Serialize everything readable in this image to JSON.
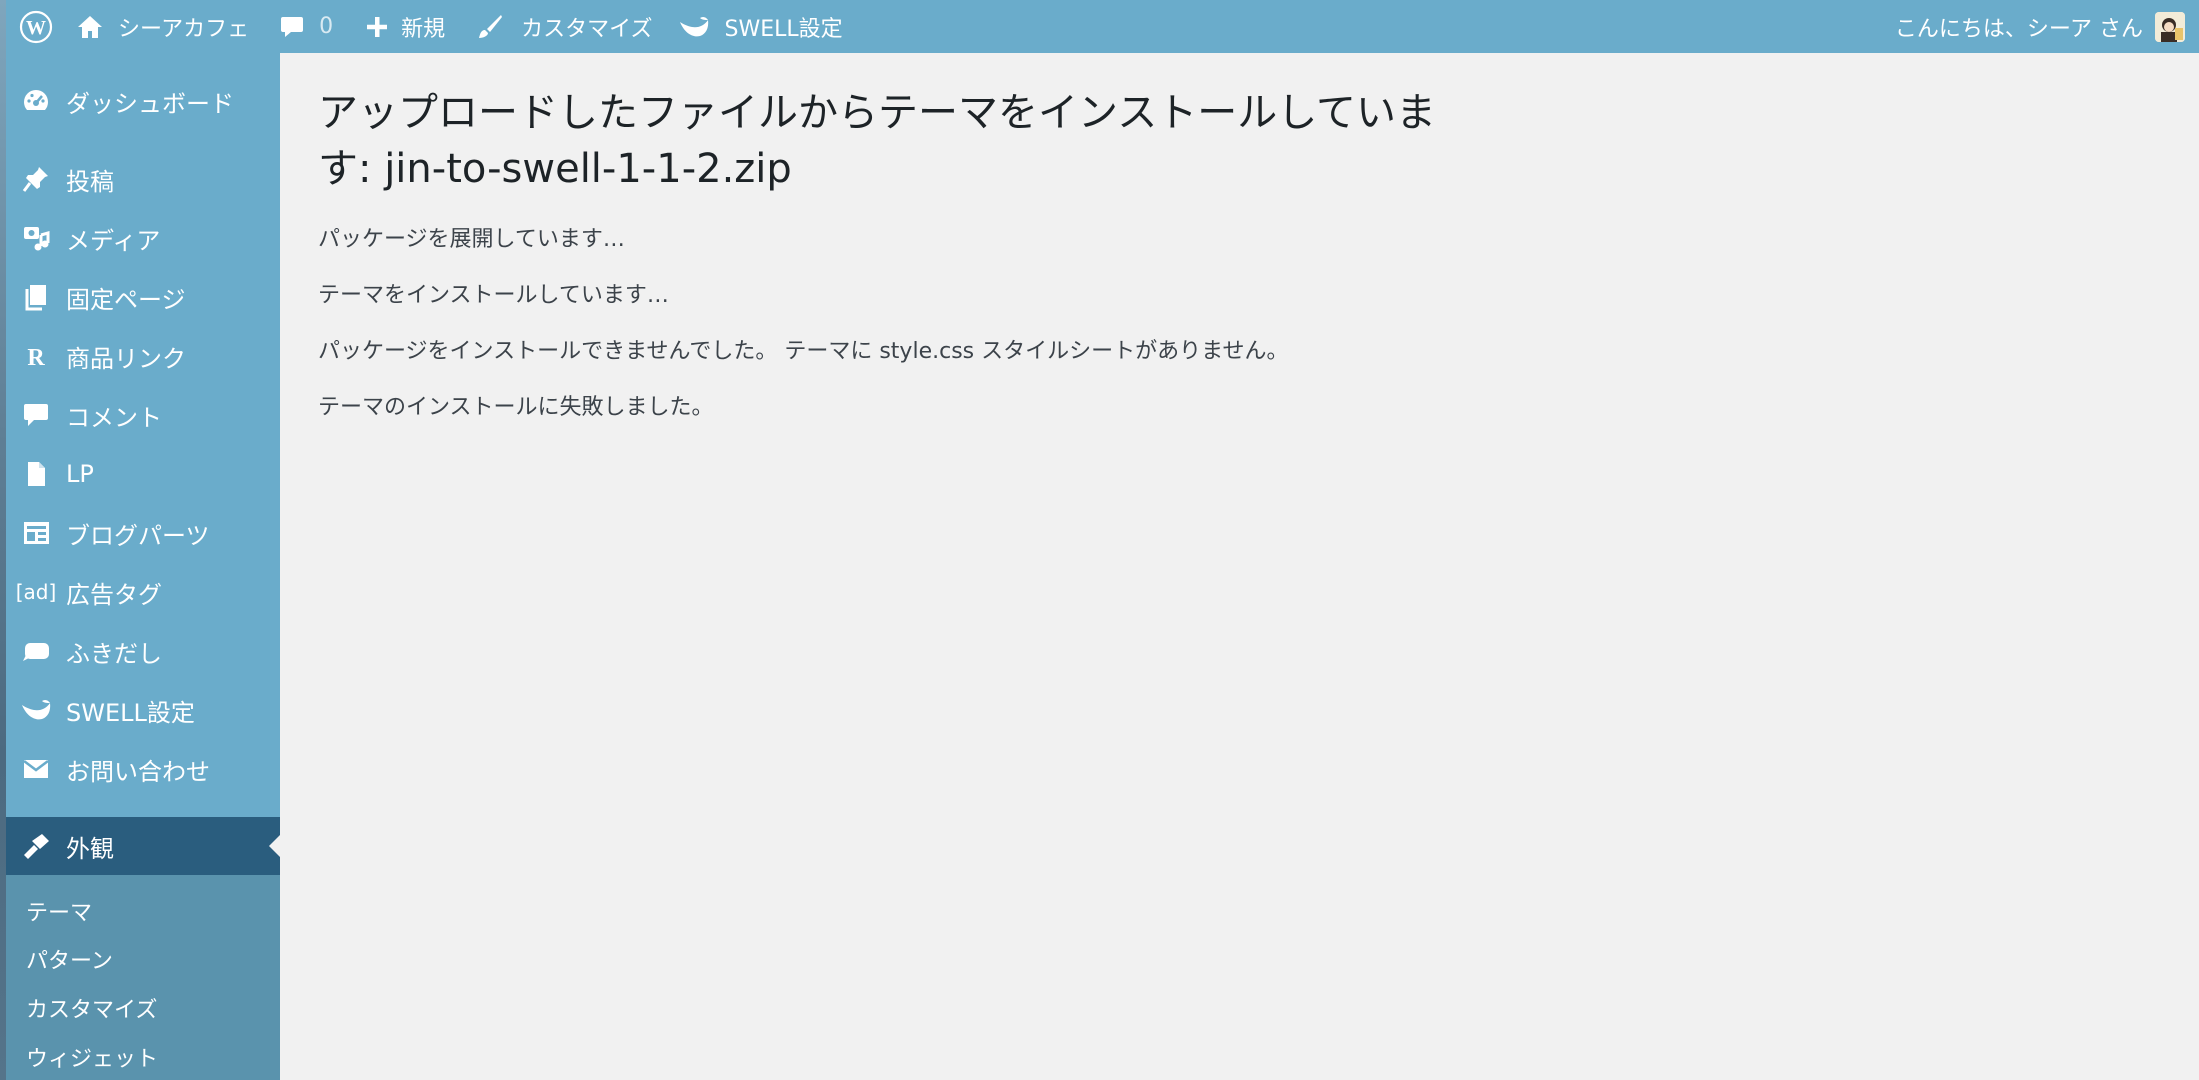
{
  "adminbar": {
    "site_name": "シーアカフェ",
    "comments_count": "0",
    "new_label": "新規",
    "customize_label": "カスタマイズ",
    "swell_label": "SWELL設定",
    "greeting": "こんにちは、シーア さん"
  },
  "sidebar": {
    "items": [
      {
        "label": "ダッシュボード",
        "icon": "dashboard-icon"
      },
      {
        "label": "投稿",
        "icon": "pin-icon"
      },
      {
        "label": "メディア",
        "icon": "media-icon"
      },
      {
        "label": "固定ページ",
        "icon": "pages-icon"
      },
      {
        "label": "商品リンク",
        "icon": "r-icon"
      },
      {
        "label": "コメント",
        "icon": "comment-icon"
      },
      {
        "label": "LP",
        "icon": "document-icon"
      },
      {
        "label": "ブログパーツ",
        "icon": "layout-icon"
      },
      {
        "label": "広告タグ",
        "icon": "ad-icon",
        "icon_text": "[ad]"
      },
      {
        "label": "ふきだし",
        "icon": "balloon-icon"
      },
      {
        "label": "SWELL設定",
        "icon": "swell-icon"
      },
      {
        "label": "お問い合わせ",
        "icon": "mail-icon"
      },
      {
        "label": "外観",
        "icon": "brush-icon",
        "current": true
      }
    ],
    "submenu": [
      "テーマ",
      "パターン",
      "カスタマイズ",
      "ウィジェット"
    ]
  },
  "main": {
    "title_line1": "アップロードしたファイルからテーマをインストールしていま",
    "title_line2": "す: jin-to-swell-1-1-2.zip",
    "messages": [
      "パッケージを展開しています…",
      "テーマをインストールしています…",
      "パッケージをインストールできませんでした。 テーマに style.css スタイルシートがありません。",
      "テーマのインストールに失敗しました。"
    ]
  },
  "colors": {
    "adminbar_bg": "#6aaccb",
    "sidebar_bg": "#6aaccb",
    "current_item_bg": "#2a5d7e",
    "submenu_bg": "#5a93ad",
    "content_bg": "#f1f1f1"
  }
}
